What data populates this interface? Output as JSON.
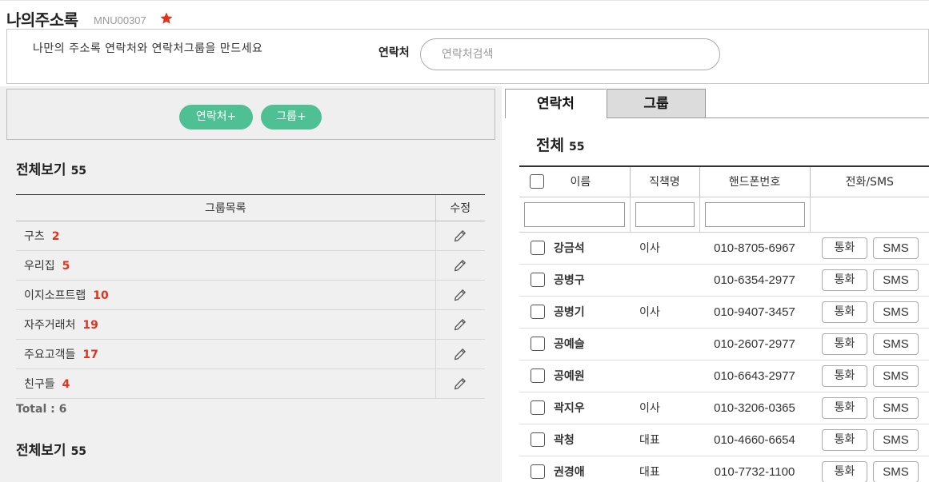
{
  "header": {
    "title": "나의주소록",
    "menu_code": "MNU00307",
    "favorite_icon": "star-icon",
    "favorite_color": "#e0321e"
  },
  "info": {
    "description": "나만의 주소록 연락처와 연락처그룹을 만드세요",
    "search_label": "연락처",
    "search_placeholder": "연락처검색",
    "search_value": ""
  },
  "left": {
    "add_contact_label": "연락처+",
    "add_group_label": "그룹+",
    "button_color": "#4fc094",
    "all_view_label": "전체보기",
    "all_view_count": "55",
    "group_header": "그룹목록",
    "edit_header": "수정",
    "groups": [
      {
        "name": "구츠",
        "count": "2"
      },
      {
        "name": "우리집",
        "count": "5"
      },
      {
        "name": "이지소프트랩",
        "count": "10"
      },
      {
        "name": "자주거래처",
        "count": "19"
      },
      {
        "name": "주요고객들",
        "count": "17"
      },
      {
        "name": "친구들",
        "count": "4"
      }
    ],
    "total_label": "Total : 6",
    "all_view_label_2": "전체보기",
    "all_view_count_2": "55"
  },
  "right": {
    "tabs": [
      {
        "label": "연락처",
        "active": true
      },
      {
        "label": "그룹",
        "active": false
      }
    ],
    "list_title": "전체",
    "list_count": "55",
    "columns": [
      "이름",
      "직책명",
      "핸드폰번호",
      "전화/SMS"
    ],
    "call_label": "통화",
    "sms_label": "SMS",
    "contacts": [
      {
        "name": "강금석",
        "title": "이사",
        "phone": "010-8705-6967"
      },
      {
        "name": "공병구",
        "title": "",
        "phone": "010-6354-2977"
      },
      {
        "name": "공병기",
        "title": "이사",
        "phone": "010-9407-3457"
      },
      {
        "name": "공예슬",
        "title": "",
        "phone": "010-2607-2977"
      },
      {
        "name": "공예원",
        "title": "",
        "phone": "010-6643-2977"
      },
      {
        "name": "곽지우",
        "title": "이사",
        "phone": "010-3206-0365"
      },
      {
        "name": "곽청",
        "title": "대표",
        "phone": "010-4660-6654"
      },
      {
        "name": "권경애",
        "title": "대표",
        "phone": "010-7732-1100"
      }
    ]
  }
}
